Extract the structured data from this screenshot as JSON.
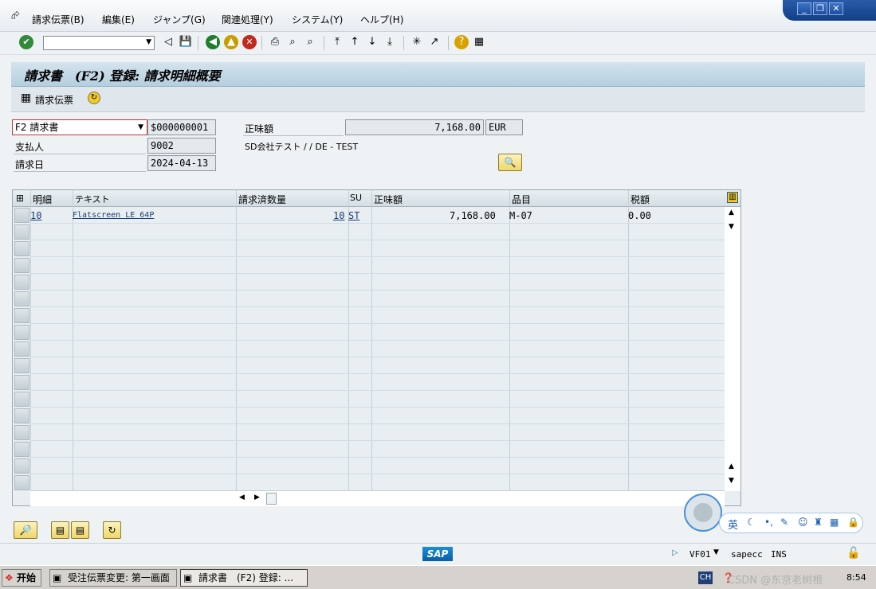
{
  "menu": {
    "items": [
      "請求伝票(B)",
      "編集(E)",
      "ジャンプ(G)",
      "関連処理(Y)",
      "システム(Y)",
      "ヘルプ(H)"
    ]
  },
  "title": "請求書　(F2) 登録: 請求明細概要",
  "app_toolbar": {
    "billing_docs": "請求伝票"
  },
  "header": {
    "doc_type": "F2 請求書",
    "doc_number": "$000000001",
    "net_value_label": "正味額",
    "net_value": "7,168.00",
    "currency": "EUR",
    "payer_label": "支払人",
    "payer": "9002",
    "payer_text": "SD会社テスト / / DE - TEST",
    "billing_date_label": "請求日",
    "billing_date": "2024-04-13"
  },
  "table": {
    "columns": [
      "明細",
      "テキスト",
      "請求済数量",
      "SU",
      "正味額",
      "品目",
      "税額"
    ],
    "rows": [
      {
        "item": "10",
        "text": "Flatscreen LE 64P",
        "qty": "10",
        "su": "ST",
        "net": "7,168.00",
        "material": "M-07",
        "tax": "0.00"
      }
    ]
  },
  "status": {
    "system": "SAP",
    "tcode": "VF01",
    "server": "sapecc",
    "mode": "INS"
  },
  "taskbar": {
    "start": "开始",
    "task1": "受注伝票変更: 第一画面",
    "task2": "請求書　(F2) 登録: ...",
    "lang": "CH",
    "time": "8:54",
    "watermark": "CSDN @东京老树根"
  },
  "ime": {
    "label": "英"
  }
}
